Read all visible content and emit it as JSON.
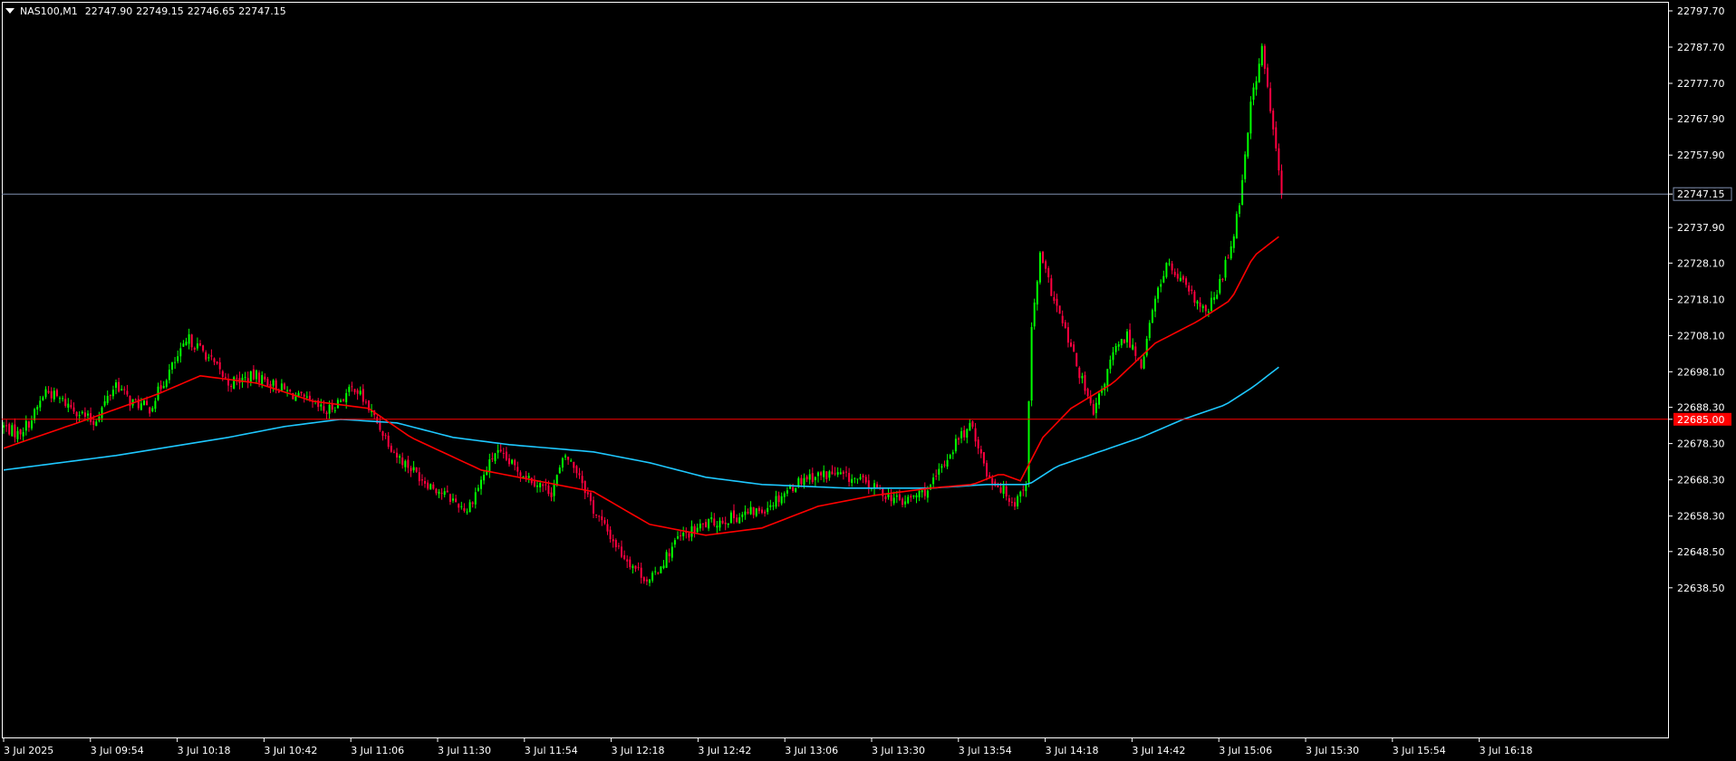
{
  "header": {
    "symbol": "NAS100,M1",
    "open": "22747.90",
    "high": "22749.15",
    "low": "22746.65",
    "close": "22747.15"
  },
  "colors": {
    "background": "#000000",
    "frame": "#ffffff",
    "bull": "#00ff00",
    "bear": "#ff0040",
    "ma_fast": "#ff0000",
    "ma_slow": "#1ec8ff",
    "bid_line": "#8090b0",
    "level_line": "#ff0000",
    "axis_text": "#ffffff"
  },
  "chart_data": {
    "type": "candlestick",
    "symbol": "NAS100",
    "timeframe": "M1",
    "ylim": [
      22634.0,
      22800.0
    ],
    "y_ticks": [
      "22797.70",
      "22787.70",
      "22777.70",
      "22767.90",
      "22757.90",
      "22747.15",
      "22737.90",
      "22728.10",
      "22718.10",
      "22708.10",
      "22698.10",
      "22688.30",
      "22685.00",
      "22678.30",
      "22668.30",
      "22658.30",
      "22648.50",
      "22638.50"
    ],
    "x_ticks": [
      "3 Jul 2025",
      "3 Jul 09:54",
      "3 Jul 10:18",
      "3 Jul 10:42",
      "3 Jul 11:06",
      "3 Jul 11:30",
      "3 Jul 11:54",
      "3 Jul 12:18",
      "3 Jul 12:42",
      "3 Jul 13:06",
      "3 Jul 13:30",
      "3 Jul 13:54",
      "3 Jul 14:18",
      "3 Jul 14:42",
      "3 Jul 15:06",
      "3 Jul 15:30",
      "3 Jul 15:54",
      "3 Jul 16:18"
    ],
    "bid": {
      "value": 22747.15,
      "label": "22747.15"
    },
    "level": {
      "value": 22685.0,
      "label": "22685.00"
    },
    "close_anchors": [
      [
        0,
        22683
      ],
      [
        5,
        22681
      ],
      [
        10,
        22685
      ],
      [
        15,
        22693
      ],
      [
        25,
        22688
      ],
      [
        32,
        22684
      ],
      [
        40,
        22695
      ],
      [
        45,
        22690
      ],
      [
        52,
        22688
      ],
      [
        58,
        22697
      ],
      [
        66,
        22707
      ],
      [
        72,
        22703
      ],
      [
        80,
        22695
      ],
      [
        90,
        22697
      ],
      [
        100,
        22693
      ],
      [
        115,
        22687
      ],
      [
        125,
        22694
      ],
      [
        130,
        22688
      ],
      [
        140,
        22675
      ],
      [
        150,
        22668
      ],
      [
        165,
        22660
      ],
      [
        175,
        22676
      ],
      [
        185,
        22670
      ],
      [
        195,
        22665
      ],
      [
        200,
        22675
      ],
      [
        205,
        22670
      ],
      [
        210,
        22660
      ],
      [
        220,
        22648
      ],
      [
        230,
        22640
      ],
      [
        240,
        22652
      ],
      [
        250,
        22656
      ],
      [
        270,
        22660
      ],
      [
        285,
        22669
      ],
      [
        295,
        22670
      ],
      [
        305,
        22668
      ],
      [
        320,
        22662
      ],
      [
        330,
        22666
      ],
      [
        340,
        22680
      ],
      [
        345,
        22683
      ],
      [
        350,
        22670
      ],
      [
        360,
        22662
      ],
      [
        364,
        22668
      ],
      [
        366,
        22710
      ],
      [
        369,
        22730
      ],
      [
        374,
        22718
      ],
      [
        382,
        22700
      ],
      [
        388,
        22686
      ],
      [
        395,
        22703
      ],
      [
        400,
        22708
      ],
      [
        405,
        22700
      ],
      [
        410,
        22718
      ],
      [
        414,
        22728
      ],
      [
        420,
        22722
      ],
      [
        428,
        22714
      ],
      [
        432,
        22720
      ],
      [
        437,
        22733
      ],
      [
        440,
        22745
      ],
      [
        444,
        22772
      ],
      [
        448,
        22787
      ],
      [
        452,
        22765
      ],
      [
        455,
        22747
      ]
    ],
    "ma_fast_anchors": [
      [
        0,
        22677
      ],
      [
        30,
        22685
      ],
      [
        55,
        22692
      ],
      [
        70,
        22697
      ],
      [
        90,
        22695
      ],
      [
        110,
        22690
      ],
      [
        130,
        22688
      ],
      [
        145,
        22680
      ],
      [
        170,
        22671
      ],
      [
        190,
        22668
      ],
      [
        210,
        22665
      ],
      [
        230,
        22656
      ],
      [
        250,
        22653
      ],
      [
        270,
        22655
      ],
      [
        290,
        22661
      ],
      [
        310,
        22664
      ],
      [
        330,
        22666
      ],
      [
        345,
        22667
      ],
      [
        355,
        22670
      ],
      [
        362,
        22668
      ],
      [
        370,
        22680
      ],
      [
        380,
        22688
      ],
      [
        395,
        22695
      ],
      [
        410,
        22706
      ],
      [
        425,
        22712
      ],
      [
        437,
        22718
      ],
      [
        445,
        22730
      ],
      [
        455,
        22736
      ]
    ],
    "ma_slow_anchors": [
      [
        0,
        22671
      ],
      [
        40,
        22675
      ],
      [
        80,
        22680
      ],
      [
        100,
        22683
      ],
      [
        120,
        22685
      ],
      [
        140,
        22684
      ],
      [
        160,
        22680
      ],
      [
        180,
        22678
      ],
      [
        210,
        22676
      ],
      [
        230,
        22673
      ],
      [
        250,
        22669
      ],
      [
        270,
        22667
      ],
      [
        300,
        22666
      ],
      [
        330,
        22666
      ],
      [
        350,
        22667
      ],
      [
        365,
        22667
      ],
      [
        375,
        22672
      ],
      [
        390,
        22676
      ],
      [
        405,
        22680
      ],
      [
        420,
        22685
      ],
      [
        435,
        22689
      ],
      [
        445,
        22694
      ],
      [
        455,
        22700
      ]
    ]
  }
}
